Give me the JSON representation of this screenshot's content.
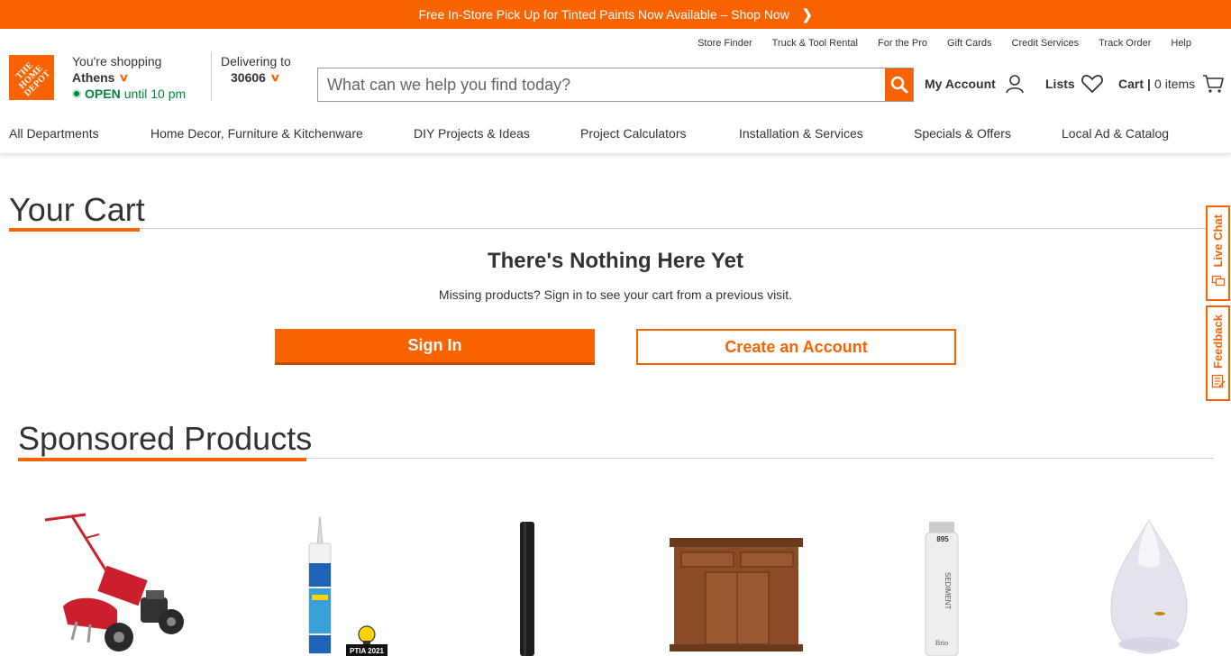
{
  "promo": {
    "text": "Free In-Store Pick Up for Tinted Paints Now Available – Shop Now"
  },
  "utility_links": [
    "Store Finder",
    "Truck & Tool Rental",
    "For the Pro",
    "Gift Cards",
    "Credit Services",
    "Track Order",
    "Help"
  ],
  "logo": {
    "text": "THE HOME DEPOT"
  },
  "store": {
    "label": "You're shopping",
    "city": "Athens",
    "status": "OPEN",
    "hours": "until 10 pm"
  },
  "delivery": {
    "label": "Delivering to",
    "zip": "30606"
  },
  "search": {
    "placeholder": "What can we help you find today?"
  },
  "account": {
    "label": "My Account"
  },
  "lists": {
    "label": "Lists"
  },
  "cart": {
    "label": "Cart",
    "sep": "|",
    "count": "0",
    "items": "items"
  },
  "nav": [
    "All Departments",
    "Home Decor, Furniture & Kitchenware",
    "DIY Projects & Ideas",
    "Project Calculators",
    "Installation & Services",
    "Specials & Offers",
    "Local Ad & Catalog"
  ],
  "main": {
    "title": "Your Cart",
    "empty_heading": "There's Nothing Here Yet",
    "empty_text": "Missing products? Sign in to see your cart from a previous visit.",
    "sign_in": "Sign In",
    "create_account": "Create an Account"
  },
  "side_tabs": {
    "live_chat": "Live Chat",
    "feedback": "Feedback"
  },
  "sponsored": {
    "title": "Sponsored Products",
    "products": [
      {
        "icon": "tiller-image"
      },
      {
        "icon": "caulk-tube-image",
        "badge": "PTIA 2021"
      },
      {
        "icon": "tower-fan-image"
      },
      {
        "icon": "kitchen-island-image"
      },
      {
        "icon": "water-filter-image",
        "filter_label": "SEDIMENT",
        "filter_code": "895",
        "filter_brand": "Brio"
      },
      {
        "icon": "humidifier-image"
      }
    ]
  },
  "colors": {
    "brand_orange": "#f96302",
    "open_green": "#00873c"
  }
}
